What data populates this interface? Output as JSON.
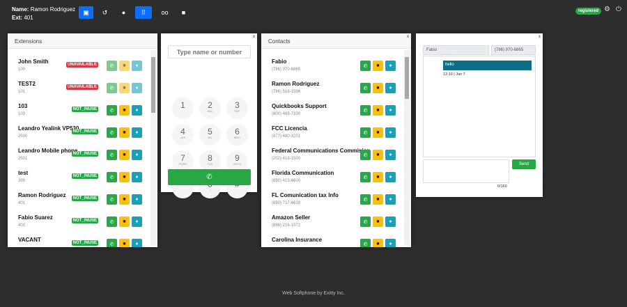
{
  "header": {
    "name_label": "Name:",
    "name": "Ramon Rodriguez",
    "ext_label": "Ext:",
    "ext": "401",
    "status": "registered"
  },
  "extensions": {
    "title": "Extensions",
    "items": [
      {
        "name": "John Smith",
        "ext": "100",
        "status": "UNAVAILABLE"
      },
      {
        "name": "TEST2",
        "ext": "101",
        "status": "UNAVAILABLE"
      },
      {
        "name": "103",
        "ext": "103",
        "status": "NOT_INUSE"
      },
      {
        "name": "Leandro Yealink VP530",
        "ext": "2500",
        "status": "NOT_INUSE"
      },
      {
        "name": "Leandro Mobile phone",
        "ext": "2501",
        "status": "NOT_INUSE"
      },
      {
        "name": "test",
        "ext": "399",
        "status": "NOT_INUSE"
      },
      {
        "name": "Ramon Rodriguez",
        "ext": "401",
        "status": "NOT_INUSE"
      },
      {
        "name": "Fabio Suarez",
        "ext": "402",
        "status": "NOT_INUSE"
      },
      {
        "name": "VACANT",
        "ext": "",
        "status": "NOT_INUSE"
      }
    ]
  },
  "dialpad": {
    "placeholder": "Type name or number",
    "close": "x",
    "keys": [
      {
        "d": "1",
        "l": ""
      },
      {
        "d": "2",
        "l": "ABC"
      },
      {
        "d": "3",
        "l": "DEF"
      },
      {
        "d": "4",
        "l": "GHI"
      },
      {
        "d": "5",
        "l": "JKL"
      },
      {
        "d": "6",
        "l": "MNO"
      },
      {
        "d": "7",
        "l": "PQRS"
      },
      {
        "d": "8",
        "l": "TUV"
      },
      {
        "d": "9",
        "l": "WXYZ"
      },
      {
        "d": "*",
        "l": ""
      },
      {
        "d": "0",
        "l": "+"
      },
      {
        "d": "#",
        "l": ""
      }
    ]
  },
  "contacts": {
    "title": "Contacts",
    "close": "x",
    "items": [
      {
        "name": "Fabio",
        "phone": "(786) 970-6865"
      },
      {
        "name": "Ramon Rodriguez",
        "phone": "(786) 516-1596"
      },
      {
        "name": "Quickbooks Support",
        "phone": "(800) 488-7330"
      },
      {
        "name": "FCC Licencia",
        "phone": "(877) 480-3201"
      },
      {
        "name": "Federal Communications Commision",
        "phone": "(202) 418-1500"
      },
      {
        "name": "Florida Communication",
        "phone": "(850) 413-6600"
      },
      {
        "name": "FL Comunication tax Info",
        "phone": "(850) 717-6628"
      },
      {
        "name": "Amazon Seller",
        "phone": "(866) 216-1072"
      },
      {
        "name": "Carolina Insurance",
        "phone": ""
      }
    ]
  },
  "chat": {
    "close": "x",
    "contact_name": "Fabio",
    "contact_phone": "(786) 970-6865",
    "messages": [
      {
        "text": "hello",
        "time": "13:10 | Jan 7"
      }
    ],
    "send": "Send",
    "counter": "0/160"
  },
  "footer": "Web Softphone by Exitty Inc.",
  "colors": {
    "status_unavailable": "#dc3545",
    "status_ok": "#28a745"
  }
}
